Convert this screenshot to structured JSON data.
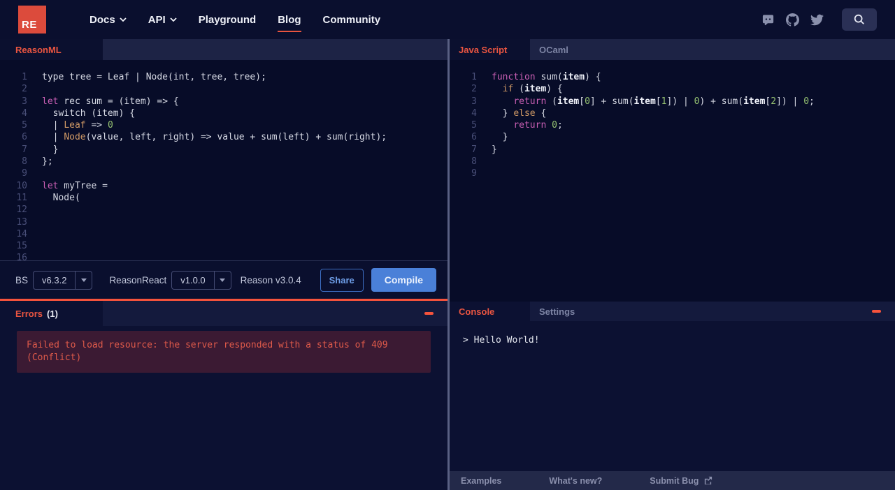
{
  "nav": {
    "logo": "RE",
    "items": [
      {
        "label": "Docs",
        "chevron": true
      },
      {
        "label": "API",
        "chevron": true
      },
      {
        "label": "Playground",
        "chevron": false
      },
      {
        "label": "Blog",
        "chevron": false,
        "active": true
      },
      {
        "label": "Community",
        "chevron": false
      }
    ],
    "social_icons": [
      "discord-icon",
      "github-icon",
      "twitter-icon"
    ],
    "search_icon": "search-icon"
  },
  "colors": {
    "accent": "#f6533c",
    "logo_bg": "#dc4b3c",
    "compile_blue": "#4a80d8"
  },
  "left": {
    "tab": "ReasonML",
    "editor": {
      "line_count": 18,
      "lines": [
        [
          {
            "t": "type tree = Leaf | Node(int, tree, tree);",
            "c": "d"
          }
        ],
        [],
        [
          {
            "t": "let",
            "c": "k"
          },
          {
            "t": " rec sum = (item) => {",
            "c": "d"
          }
        ],
        [
          {
            "t": "  switch (item) {",
            "c": "d"
          }
        ],
        [
          {
            "t": "  | ",
            "c": "d"
          },
          {
            "t": "Leaf",
            "c": "v"
          },
          {
            "t": " => ",
            "c": "d"
          },
          {
            "t": "0",
            "c": "n"
          }
        ],
        [
          {
            "t": "  | ",
            "c": "d"
          },
          {
            "t": "Node",
            "c": "v"
          },
          {
            "t": "(value, left, right) => value + sum(left) + sum(right);",
            "c": "d"
          }
        ],
        [
          {
            "t": "  }",
            "c": "d"
          }
        ],
        [
          {
            "t": "};",
            "c": "d"
          }
        ],
        [],
        [
          {
            "t": "let",
            "c": "k"
          },
          {
            "t": " myTree =",
            "c": "d"
          }
        ],
        [
          {
            "t": "  Node(",
            "c": "d"
          }
        ]
      ]
    },
    "toolbar": {
      "bs_label": "BS",
      "bs_version": "v6.3.2",
      "reasonreact_label": "ReasonReact",
      "reasonreact_version": "v1.0.0",
      "reason_version": "Reason v3.0.4",
      "share_label": "Share",
      "compile_label": "Compile"
    },
    "errors": {
      "title": "Errors",
      "count": "(1)",
      "message": "Failed to load resource: the server responded with a status of 409 (Conflict)"
    }
  },
  "right": {
    "tabs": {
      "js": "Java Script",
      "ocaml": "OCaml"
    },
    "editor": {
      "line_count": 9,
      "lines": [
        [
          {
            "t": "function",
            "c": "k"
          },
          {
            "t": " sum(",
            "c": "d"
          },
          {
            "t": "item",
            "c": "b"
          },
          {
            "t": ") {",
            "c": "d"
          }
        ],
        [
          {
            "t": "  ",
            "c": "d"
          },
          {
            "t": "if",
            "c": "v"
          },
          {
            "t": " (",
            "c": "d"
          },
          {
            "t": "item",
            "c": "b"
          },
          {
            "t": ") {",
            "c": "d"
          }
        ],
        [
          {
            "t": "    ",
            "c": "d"
          },
          {
            "t": "return",
            "c": "k"
          },
          {
            "t": " (",
            "c": "d"
          },
          {
            "t": "item",
            "c": "b"
          },
          {
            "t": "[",
            "c": "d"
          },
          {
            "t": "0",
            "c": "n"
          },
          {
            "t": "] + sum(",
            "c": "d"
          },
          {
            "t": "item",
            "c": "b"
          },
          {
            "t": "[",
            "c": "d"
          },
          {
            "t": "1",
            "c": "n"
          },
          {
            "t": "]) | ",
            "c": "d"
          },
          {
            "t": "0",
            "c": "n"
          },
          {
            "t": ") + sum(",
            "c": "d"
          },
          {
            "t": "item",
            "c": "b"
          },
          {
            "t": "[",
            "c": "d"
          },
          {
            "t": "2",
            "c": "n"
          },
          {
            "t": "]) | ",
            "c": "d"
          },
          {
            "t": "0",
            "c": "n"
          },
          {
            "t": ";",
            "c": "d"
          }
        ],
        [
          {
            "t": "  } ",
            "c": "d"
          },
          {
            "t": "else",
            "c": "v"
          },
          {
            "t": " {",
            "c": "d"
          }
        ],
        [
          {
            "t": "    ",
            "c": "d"
          },
          {
            "t": "return",
            "c": "k"
          },
          {
            "t": " ",
            "c": "d"
          },
          {
            "t": "0",
            "c": "n"
          },
          {
            "t": ";",
            "c": "d"
          }
        ],
        [
          {
            "t": "  }",
            "c": "d"
          }
        ],
        [
          {
            "t": "}",
            "c": "d"
          }
        ]
      ]
    },
    "console": {
      "tab_console": "Console",
      "tab_settings": "Settings",
      "output": "> Hello World!"
    },
    "footer": {
      "examples": "Examples",
      "whats_new": "What's new?",
      "submit_bug": "Submit Bug"
    }
  }
}
